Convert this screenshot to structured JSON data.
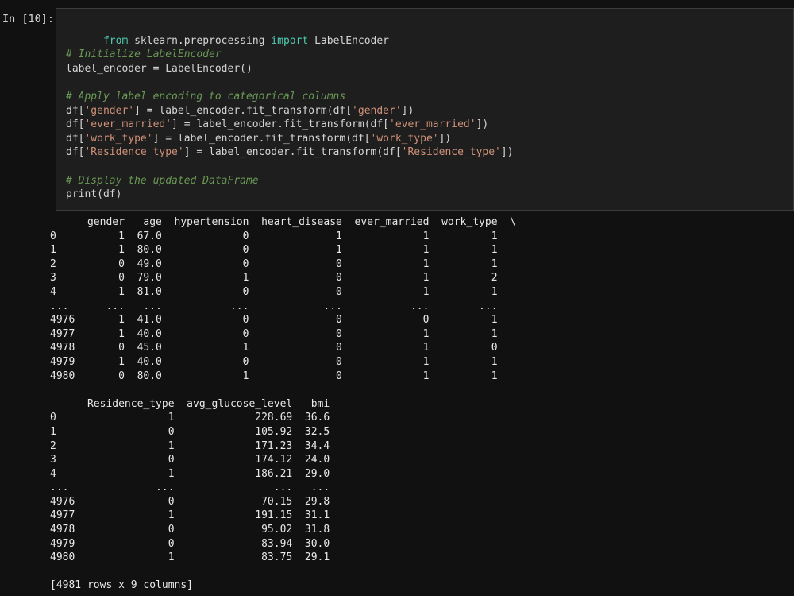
{
  "prompt": "In [10]:",
  "code": [
    "from sklearn.preprocessing import LabelEncoder",
    "",
    "# Initialize LabelEncoder",
    "label_encoder = LabelEncoder()",
    "",
    "# Apply label encoding to categorical columns",
    "df['gender'] = label_encoder.fit_transform(df['gender'])",
    "df['ever_married'] = label_encoder.fit_transform(df['ever_married'])",
    "df['work_type'] = label_encoder.fit_transform(df['work_type'])",
    "df['Residence_type'] = label_encoder.fit_transform(df['Residence_type'])",
    "",
    "# Display the updated DataFrame",
    "print(df)"
  ],
  "output": {
    "table1": [
      "      gender   age  hypertension  heart_disease  ever_married  work_type  \\",
      "0          1  67.0             0              1             1          1",
      "1          1  80.0             0              1             1          1",
      "2          0  49.0             0              0             1          1",
      "3          0  79.0             1              0             1          2",
      "4          1  81.0             0              0             1          1",
      "...      ...   ...           ...            ...           ...        ...",
      "4976       1  41.0             0              0             0          1",
      "4977       1  40.0             0              0             1          1",
      "4978       0  45.0             1              0             1          0",
      "4979       1  40.0             0              0             1          1",
      "4980       0  80.0             1              0             1          1"
    ],
    "table2": [
      "      Residence_type  avg_glucose_level   bmi",
      "0                  1             228.69  36.6",
      "1                  0             105.92  32.5",
      "2                  1             171.23  34.4",
      "3                  0             174.12  24.0",
      "4                  1             186.21  29.0",
      "...              ...                ...   ...",
      "4976               0              70.15  29.8",
      "4977               1             191.15  31.1",
      "4978               0              95.02  31.8",
      "4979               0              83.94  30.0",
      "4980               1              83.75  29.1"
    ],
    "summary": "[4981 rows x 9 columns]"
  }
}
